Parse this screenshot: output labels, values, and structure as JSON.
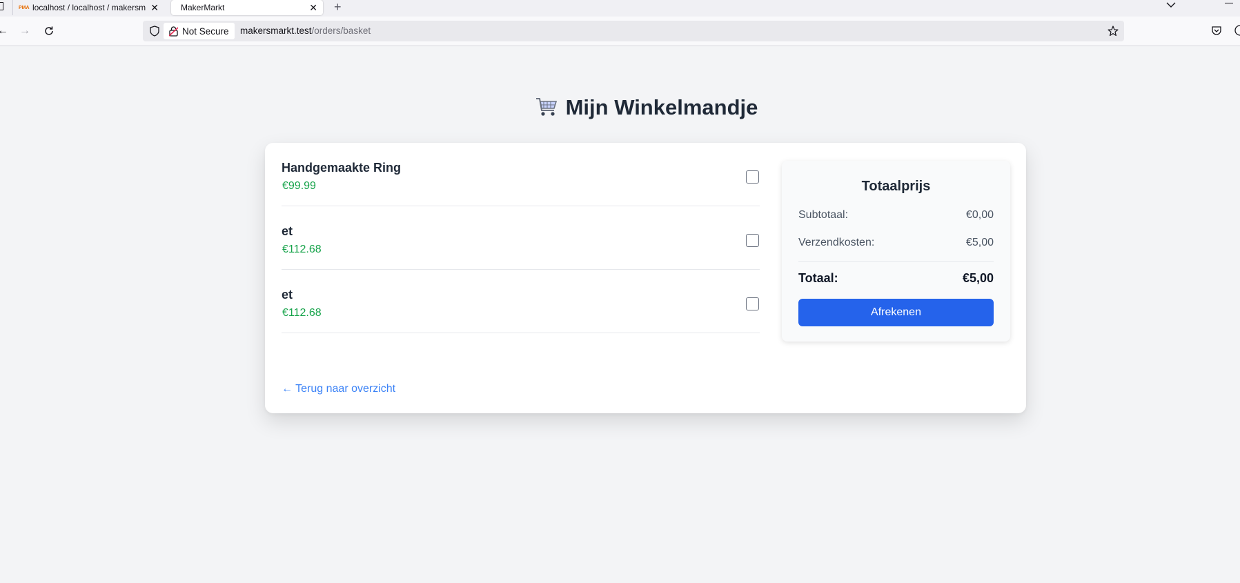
{
  "browser": {
    "tabs": [
      {
        "label": "localhost / localhost / makersm",
        "active": false
      },
      {
        "label": "MakerMarkt",
        "active": true
      }
    ],
    "security_label": "Not Secure",
    "url_host": "makersmarkt.test",
    "url_path": "/orders/basket"
  },
  "page": {
    "title": "Mijn Winkelmandje",
    "back_link": "← Terug naar overzicht"
  },
  "basket": {
    "items": [
      {
        "name": "Handgemaakte Ring",
        "price": "€99.99",
        "checked": false
      },
      {
        "name": "et",
        "price": "€112.68",
        "checked": false
      },
      {
        "name": "et",
        "price": "€112.68",
        "checked": false
      }
    ]
  },
  "summary": {
    "title": "Totaalprijs",
    "subtotal_label": "Subtotaal:",
    "subtotal_value": "€0,00",
    "shipping_label": "Verzendkosten:",
    "shipping_value": "€5,00",
    "total_label": "Totaal:",
    "total_value": "€5,00",
    "checkout_label": "Afrekenen"
  },
  "colors": {
    "accent": "#2563eb",
    "price": "#16a34a",
    "link": "#3b82f6",
    "background": "#f3f4f6"
  }
}
